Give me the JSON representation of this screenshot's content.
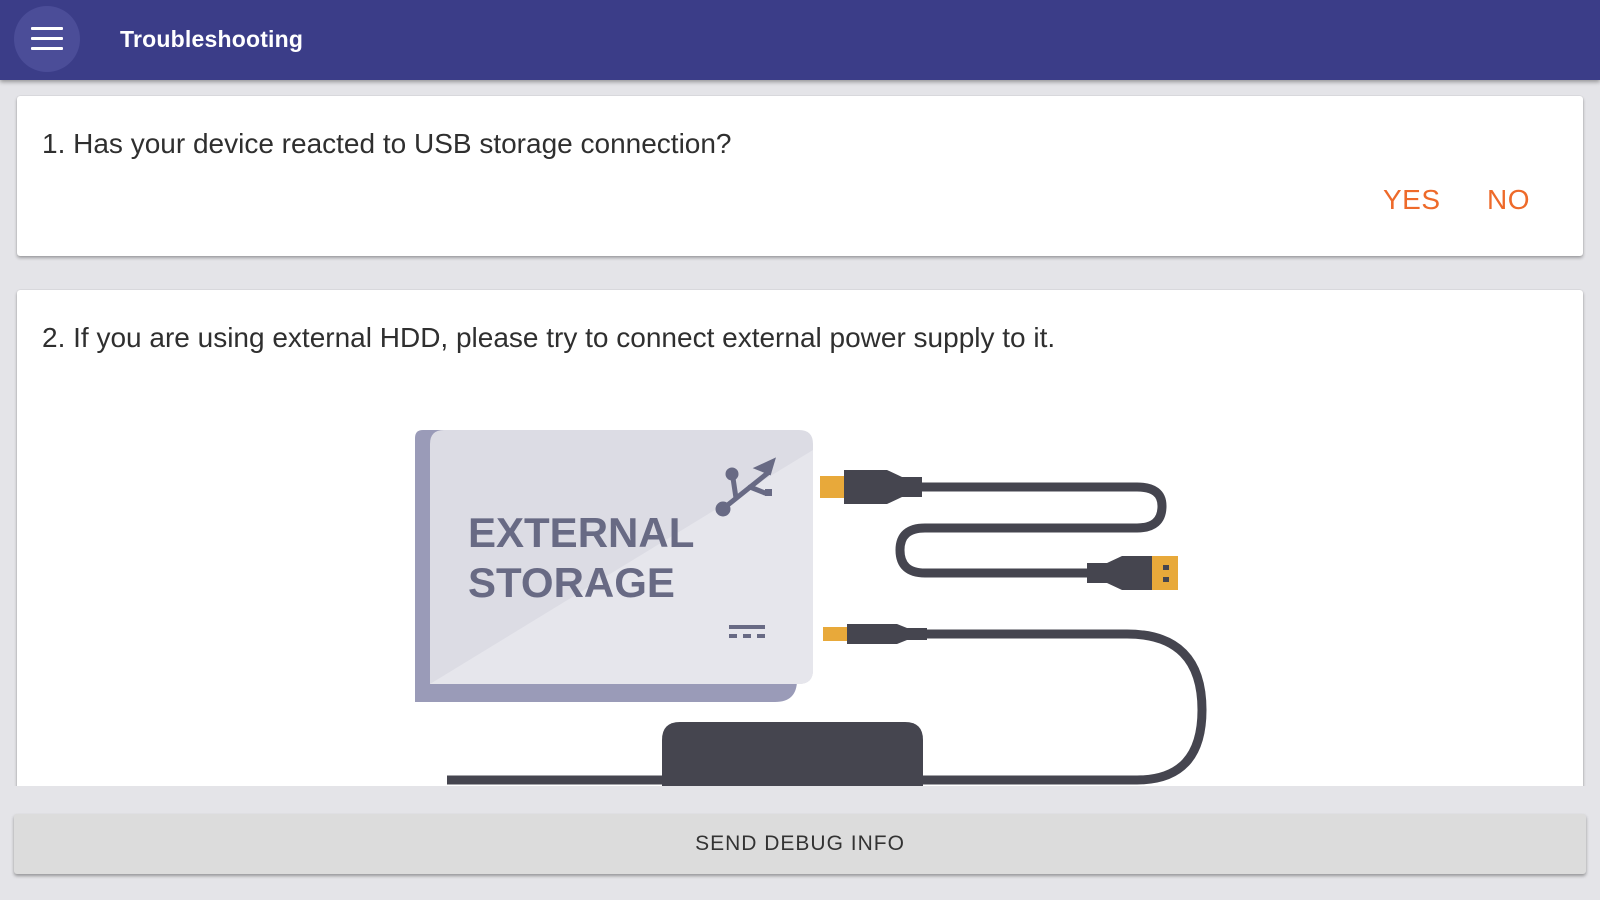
{
  "app_bar": {
    "title": "Troubleshooting",
    "menu_icon": "hamburger-menu-icon",
    "background": "#3b3d88"
  },
  "questions": [
    {
      "text": "1. Has your device reacted to USB storage connection?",
      "actions": {
        "yes_label": "YES",
        "no_label": "NO"
      }
    },
    {
      "text": "2. If you are using external HDD, please try to connect external power supply to it.",
      "illustration": {
        "device_label_line1": "EXTERNAL",
        "device_label_line2": "STORAGE",
        "icons": [
          "usb-icon",
          "dc-power-icon",
          "usb-cable-icon",
          "power-cable-icon",
          "power-adapter-icon"
        ]
      }
    }
  ],
  "footer": {
    "button_label": "SEND DEBUG INFO"
  },
  "colors": {
    "accent": "#ee6a2a",
    "cable": "#45454f",
    "device": "#dedee6",
    "connector": "#e8a93a"
  }
}
